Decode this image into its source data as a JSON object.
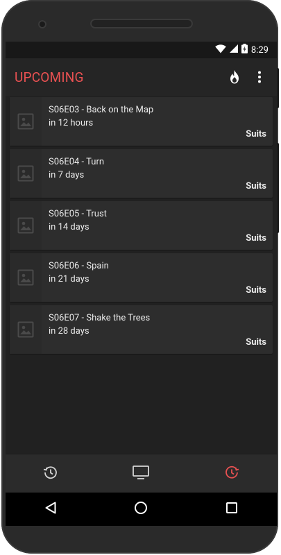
{
  "status": {
    "time": "8:29"
  },
  "appbar": {
    "title": "UPCOMING"
  },
  "episodes": [
    {
      "title": "S06E03 - Back on the Map",
      "when": "in 12 hours",
      "show": "Suits"
    },
    {
      "title": "S06E04 - Turn",
      "when": "in 7 days",
      "show": "Suits"
    },
    {
      "title": "S06E05 - Trust",
      "when": "in 14 days",
      "show": "Suits"
    },
    {
      "title": "S06E06 - Spain",
      "when": "in 21 days",
      "show": "Suits"
    },
    {
      "title": "S06E07 - Shake the Trees",
      "when": "in 28 days",
      "show": "Suits"
    }
  ],
  "bottom_nav": [
    {
      "icon": "history-icon",
      "active": false
    },
    {
      "icon": "tv-icon",
      "active": false
    },
    {
      "icon": "upcoming-clock-icon",
      "active": true
    }
  ],
  "colors": {
    "accent": "#e95152",
    "background": "#212121",
    "card": "#2d2d2d",
    "appbar": "#252525"
  },
  "system_nav": [
    "back-icon",
    "home-icon",
    "recents-icon"
  ]
}
